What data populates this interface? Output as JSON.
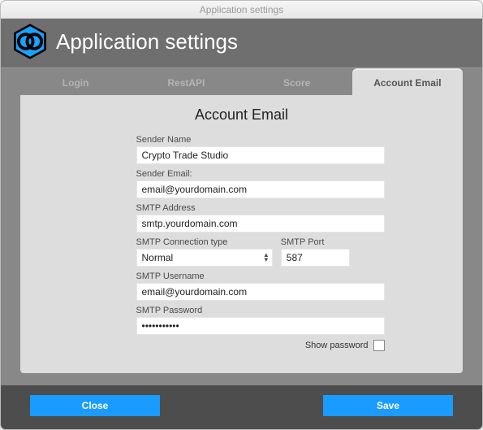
{
  "window": {
    "title": "Application settings"
  },
  "header": {
    "title": "Application settings"
  },
  "tabs": {
    "login": {
      "label": "Login"
    },
    "restapi": {
      "label": "RestAPI"
    },
    "score": {
      "label": "Score"
    },
    "account_email": {
      "label": "Account Email"
    }
  },
  "panel": {
    "heading": "Account Email"
  },
  "form": {
    "sender_name": {
      "label": "Sender Name",
      "value": "Crypto Trade Studio"
    },
    "sender_email": {
      "label": "Sender Email:",
      "value": "email@yourdomain.com"
    },
    "smtp_address": {
      "label": "SMTP Address",
      "value": "smtp.yourdomain.com"
    },
    "smtp_conn": {
      "label": "SMTP Connection type",
      "value": "Normal"
    },
    "smtp_port": {
      "label": "SMTP Port",
      "value": "587"
    },
    "smtp_user": {
      "label": "SMTP Username",
      "value": "email@yourdomain.com"
    },
    "smtp_pass": {
      "label": "SMTP Password",
      "value": "•••••••••••"
    },
    "show_password": {
      "label": "Show password"
    }
  },
  "footer": {
    "close": "Close",
    "save": "Save"
  }
}
